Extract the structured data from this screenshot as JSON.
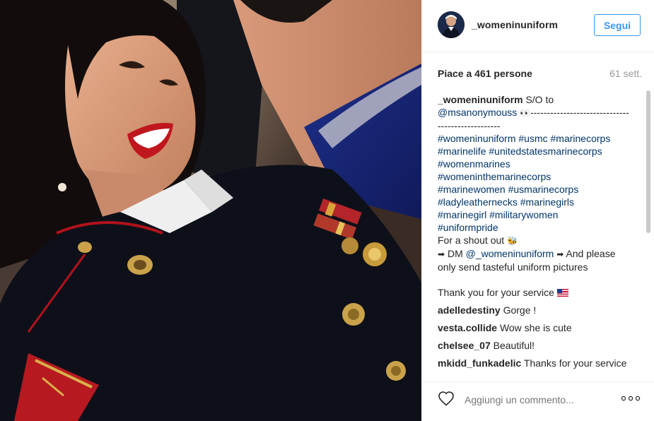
{
  "header": {
    "username": "_womeninuniform",
    "follow_label": "Segui"
  },
  "stats": {
    "likes": "Piace a 461 persone",
    "posted": "61 sett."
  },
  "caption": {
    "username": "_womeninuniform",
    "text1": "S/O to",
    "mention": "@msanonymouss",
    "eyes": "👀",
    "dashes1": "------------------------------",
    "dashes2": "-------------------",
    "hashtags": [
      [
        "#womeninuniform",
        "#usmc",
        "#marinecorps"
      ],
      [
        "#marinelife",
        "#unitedstatesmarinecorps"
      ],
      [
        "#womenmarines"
      ],
      [
        "#womeninthemarinecorps"
      ],
      [
        "#marinewomen",
        "#usmarinecorps"
      ],
      [
        "#ladyleathernecks",
        "#marinegirls"
      ],
      [
        "#marinegirl",
        "#militarywomen"
      ],
      [
        "#uniformpride"
      ]
    ],
    "shoutout": "For a shout out",
    "bee": "🐝",
    "arrow": "➡",
    "dm": "DM",
    "dm_mention": "@_womeninuniform",
    "dm_rest": "And please",
    "dm_line2": "only send tasteful uniform pictures",
    "thanks": "Thank you for your service"
  },
  "comments": [
    {
      "user": "adelledestiny",
      "text": "Gorge !"
    },
    {
      "user": "vesta.collide",
      "text": "Wow she is cute"
    },
    {
      "user": "chelsee_07",
      "text": "Beautiful!"
    },
    {
      "user": "mkidd_funkadelic",
      "text": "Thanks for your service"
    }
  ],
  "footer": {
    "comment_placeholder": "Aggiungi un commento..."
  },
  "icons": {
    "like": "heart-outline",
    "more": "more-options",
    "flag": "us-flag"
  },
  "colors": {
    "link": "#003569",
    "follow": "#3897f0",
    "muted": "#999999"
  }
}
